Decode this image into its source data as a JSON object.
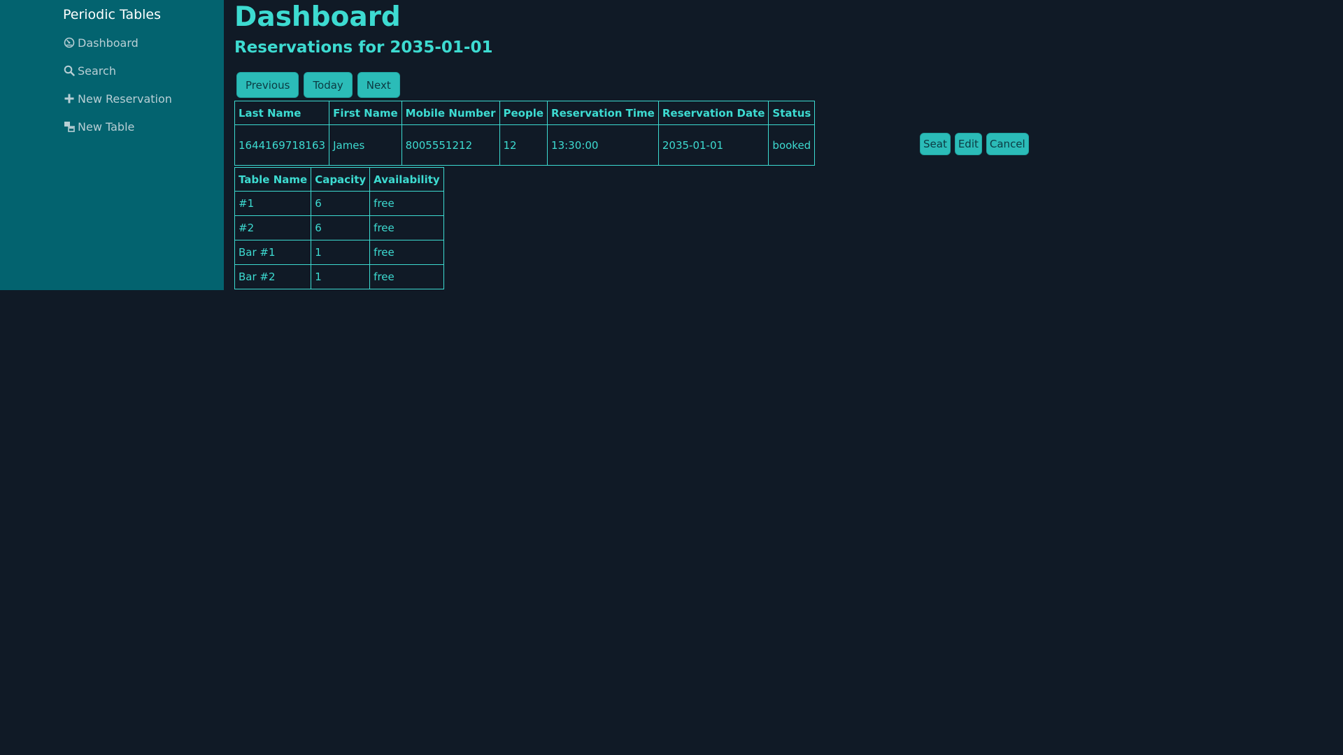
{
  "sidebar": {
    "brand": "Periodic Tables",
    "items": [
      {
        "label": "Dashboard",
        "icon": "dashboard-icon"
      },
      {
        "label": "Search",
        "icon": "search-icon"
      },
      {
        "label": "New Reservation",
        "icon": "plus-icon"
      },
      {
        "label": "New Table",
        "icon": "table-icon"
      }
    ]
  },
  "main": {
    "title": "Dashboard",
    "subtitle": "Reservations for 2035-01-01",
    "nav_buttons": {
      "previous": "Previous",
      "today": "Today",
      "next": "Next"
    },
    "reservations": {
      "headers": [
        "Last Name",
        "First Name",
        "Mobile Number",
        "People",
        "Reservation Time",
        "Reservation Date",
        "Status"
      ],
      "rows": [
        {
          "last_name": "1644169718163",
          "first_name": "James",
          "mobile_number": "8005551212",
          "people": "12",
          "time": "13:30:00",
          "date": "2035-01-01",
          "status": "booked"
        }
      ],
      "actions": {
        "seat": "Seat",
        "edit": "Edit",
        "cancel": "Cancel"
      }
    },
    "tables": {
      "headers": [
        "Table Name",
        "Capacity",
        "Availability"
      ],
      "rows": [
        {
          "name": "#1",
          "capacity": "6",
          "availability": "free"
        },
        {
          "name": "#2",
          "capacity": "6",
          "availability": "free"
        },
        {
          "name": "Bar #1",
          "capacity": "1",
          "availability": "free"
        },
        {
          "name": "Bar #2",
          "capacity": "1",
          "availability": "free"
        }
      ]
    }
  },
  "colors": {
    "background": "#101a26",
    "sidebar": "#03636f",
    "accent": "#3ddbd1",
    "button": "#2bbcb8"
  }
}
